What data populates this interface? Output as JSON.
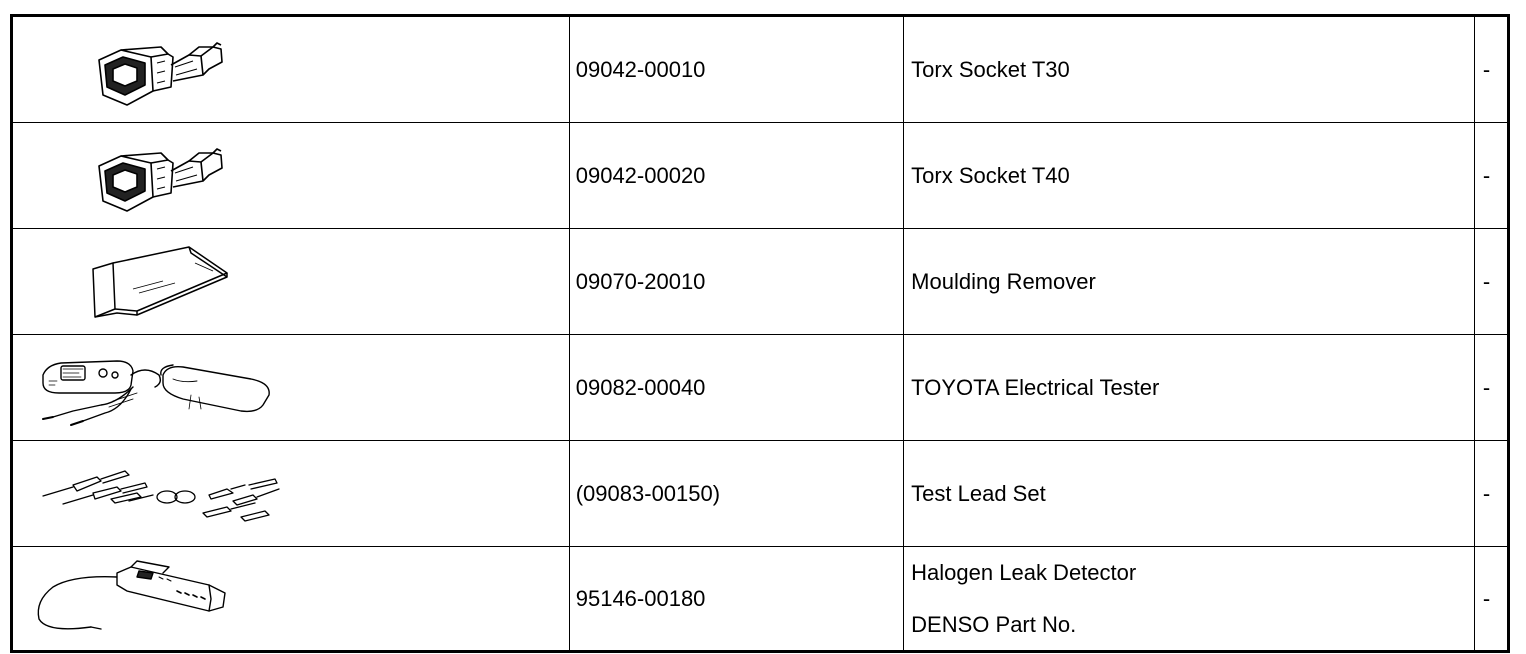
{
  "tools": [
    {
      "illustration": "torx-socket-icon",
      "part_number": "09042-00010",
      "name_lines": [
        "Torx Socket T30"
      ],
      "note": "-"
    },
    {
      "illustration": "torx-socket-icon",
      "part_number": "09042-00020",
      "name_lines": [
        "Torx Socket T40"
      ],
      "note": "-"
    },
    {
      "illustration": "moulding-remover-icon",
      "part_number": "09070-20010",
      "name_lines": [
        "Moulding Remover"
      ],
      "note": "-"
    },
    {
      "illustration": "electrical-tester-icon",
      "part_number": "09082-00040",
      "name_lines": [
        "TOYOTA Electrical Tester"
      ],
      "note": "-"
    },
    {
      "illustration": "test-lead-set-icon",
      "part_number": "(09083-00150)",
      "name_lines": [
        "Test Lead Set"
      ],
      "note": "-"
    },
    {
      "illustration": "halogen-leak-detector-icon",
      "part_number": "95146-00180",
      "name_lines": [
        "Halogen Leak Detector",
        "DENSO Part No."
      ],
      "note": "-"
    }
  ]
}
